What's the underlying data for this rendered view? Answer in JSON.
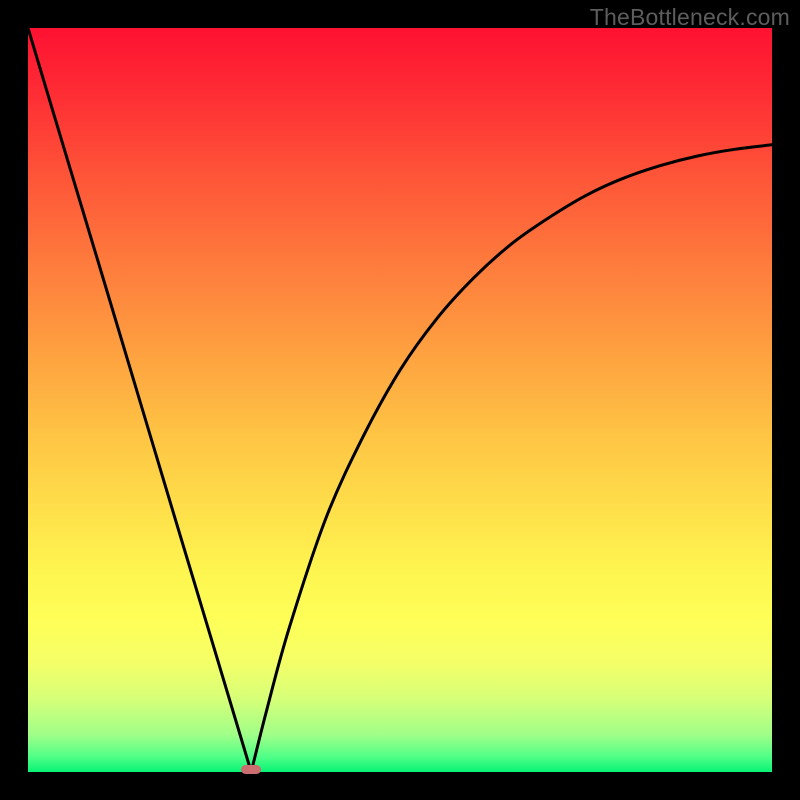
{
  "watermark": "TheBottleneck.com",
  "chart_data": {
    "type": "line",
    "title": "",
    "xlabel": "",
    "ylabel": "",
    "xlim": [
      0,
      1
    ],
    "ylim": [
      0,
      1
    ],
    "legend": false,
    "grid": false,
    "background_gradient": {
      "top_color": "#fe1131",
      "bottom_color": "#07f375",
      "stops": [
        "red",
        "orange",
        "yellow",
        "green"
      ]
    },
    "optimum_x": 0.3,
    "curve_description": "V-shaped bottleneck curve with minimum near x=0.30; left branch nearly linear steep descent from (0,1) to (0.30,0); right branch rises concavely toward ~(1,0.84).",
    "series": [
      {
        "name": "left-branch",
        "x": [
          0.0,
          0.05,
          0.1,
          0.15,
          0.2,
          0.25,
          0.28,
          0.3
        ],
        "y": [
          1.0,
          0.833,
          0.667,
          0.5,
          0.333,
          0.167,
          0.067,
          0.0
        ]
      },
      {
        "name": "right-branch",
        "x": [
          0.3,
          0.32,
          0.35,
          0.4,
          0.45,
          0.5,
          0.55,
          0.6,
          0.65,
          0.7,
          0.75,
          0.8,
          0.85,
          0.9,
          0.95,
          1.0
        ],
        "y": [
          0.0,
          0.08,
          0.19,
          0.34,
          0.45,
          0.54,
          0.61,
          0.665,
          0.71,
          0.745,
          0.775,
          0.798,
          0.815,
          0.828,
          0.837,
          0.843
        ]
      }
    ],
    "marker": {
      "x": 0.3,
      "y": 0.0,
      "color": "#cc6d6f",
      "shape": "rounded-rect"
    }
  }
}
